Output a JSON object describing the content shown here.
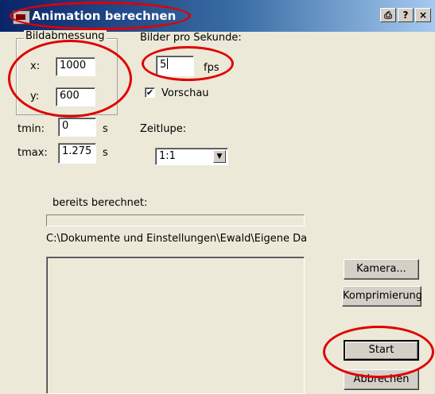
{
  "window": {
    "title": "Animation berechnen",
    "buttons": {
      "print": "⎙",
      "help": "?",
      "close": "×"
    }
  },
  "dimensions": {
    "group_label": "Bildabmessung",
    "x_label": "x:",
    "x_value": "1000",
    "y_label": "y:",
    "y_value": "600"
  },
  "fps": {
    "label": "Bilder pro Sekunde:",
    "value": "5",
    "unit": "fps"
  },
  "preview": {
    "checked": true,
    "label": "Vorschau"
  },
  "time": {
    "tmin_label": "tmin:",
    "tmin_value": "0",
    "tmin_unit": "s",
    "tmax_label": "tmax:",
    "tmax_value": "1.275",
    "tmax_unit": "s"
  },
  "slowmotion": {
    "label": "Zeitlupe:",
    "selected": "1:1"
  },
  "progress": {
    "label": "bereits berechnet:",
    "value": 0
  },
  "output_path": "C:\\Dokumente und Einstellungen\\Ewald\\Eigene Da",
  "buttons": {
    "camera": "Kamera...",
    "compression": "Komprimierung",
    "start": "Start",
    "cancel": "Abbrechen"
  },
  "annotation_color": "#e00000"
}
